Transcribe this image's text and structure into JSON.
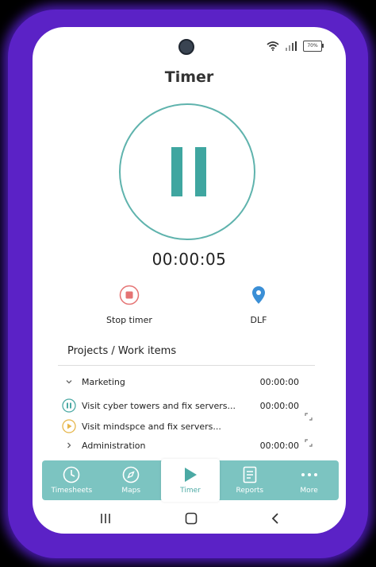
{
  "status_bar": {
    "battery": "70%"
  },
  "page_title": "Timer",
  "elapsed_time": "00:00:05",
  "actions": {
    "stop_label": "Stop timer",
    "location_label": "DLF"
  },
  "section_title": "Projects / Work items",
  "projects": [
    {
      "name": "Marketing",
      "time": "00:00:00",
      "icon": "chevron-down-icon"
    },
    {
      "name": "Visit cyber towers and fix servers...",
      "time": "00:00:00",
      "icon": "pause-circle-icon"
    },
    {
      "name": "Visit mindspce and fix servers...",
      "time": "",
      "icon": "play-circle-icon"
    },
    {
      "name": "Administration",
      "time": "00:00:00",
      "icon": "chevron-right-icon"
    }
  ],
  "bottom_nav": [
    {
      "label": "Timesheets",
      "icon": "clock-icon"
    },
    {
      "label": "Maps",
      "icon": "compass-icon"
    },
    {
      "label": "Timer",
      "icon": "play-icon",
      "active": true
    },
    {
      "label": "Reports",
      "icon": "report-icon"
    },
    {
      "label": "More",
      "icon": "more-dots-icon"
    }
  ],
  "colors": {
    "accent": "#4ba9a4",
    "nav_bg": "#7cc4c1",
    "stop": "#e57373",
    "pin": "#3b8fd6",
    "play": "#e6b64a",
    "frame": "#5b22c6"
  }
}
